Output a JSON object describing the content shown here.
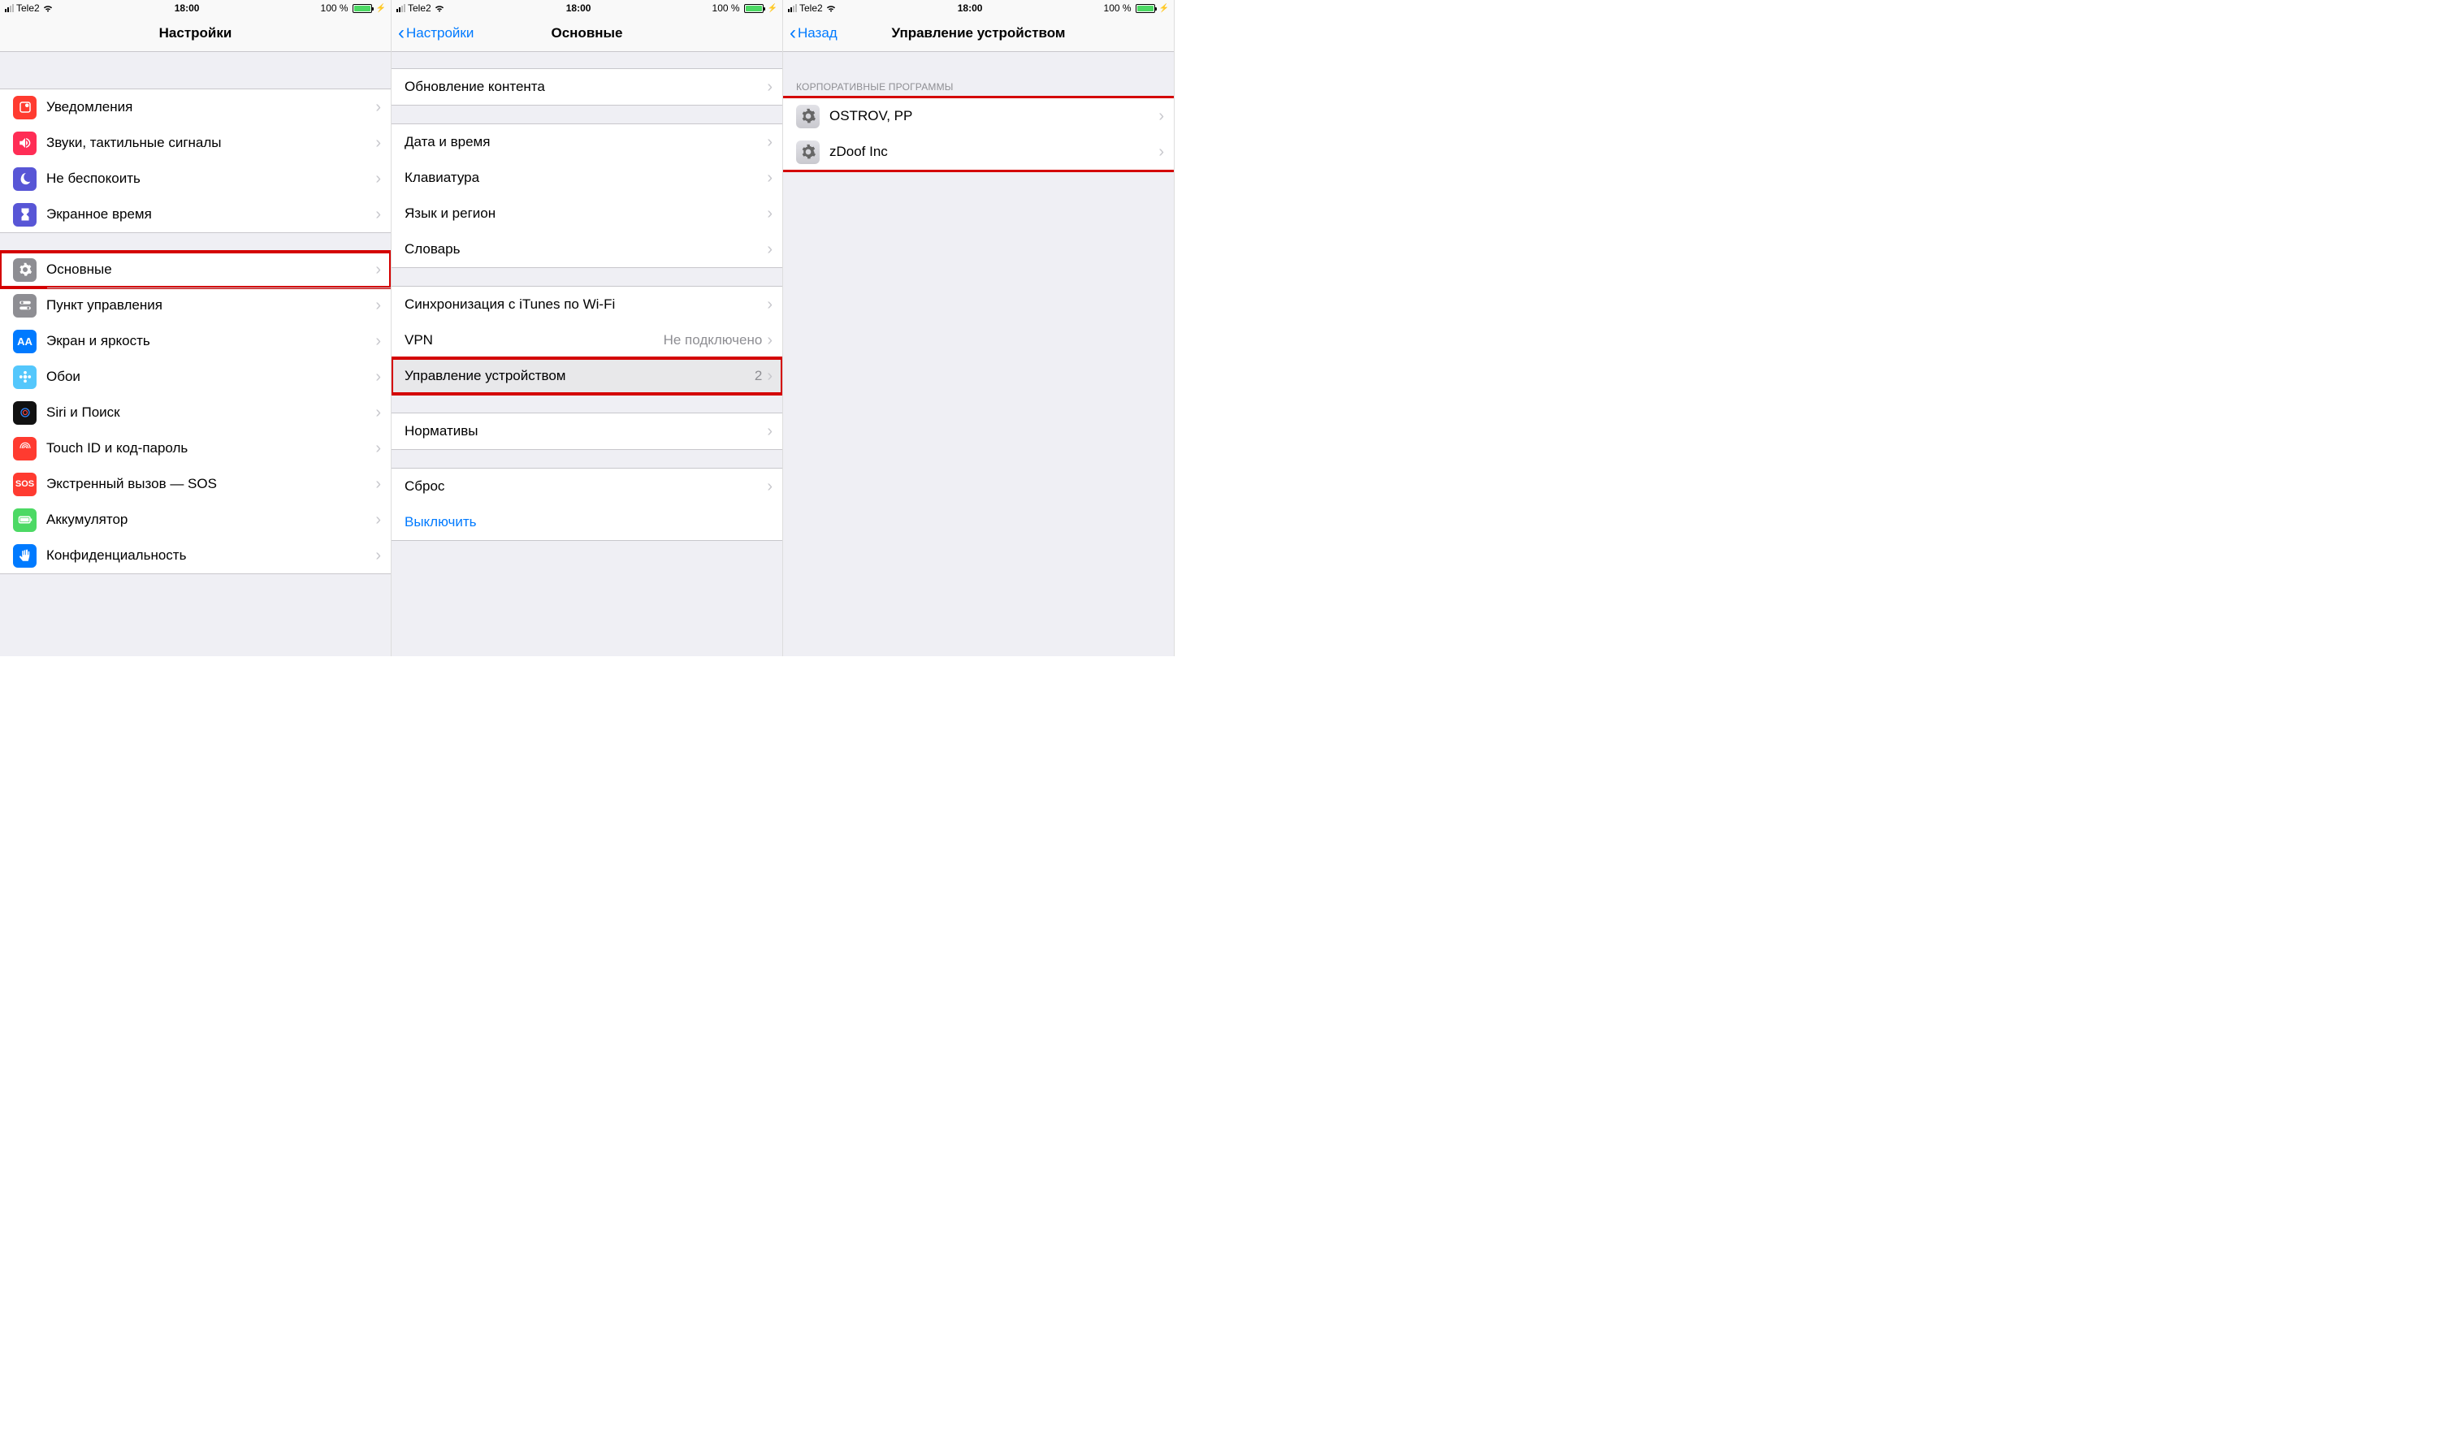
{
  "statusbar": {
    "carrier": "Tele2",
    "time": "18:00",
    "battery": "100 %"
  },
  "screen1": {
    "title": "Настройки",
    "groups": [
      {
        "rows": [
          {
            "id": "notifications",
            "label": "Уведомления",
            "icon": "bell",
            "bg": "#ff3b30"
          },
          {
            "id": "sounds",
            "label": "Звуки, тактильные сигналы",
            "icon": "speaker",
            "bg": "#ff2d55"
          },
          {
            "id": "dnd",
            "label": "Не беспокоить",
            "icon": "moon",
            "bg": "#5856d6"
          },
          {
            "id": "screentime",
            "label": "Экранное время",
            "icon": "hourglass",
            "bg": "#5856d6"
          }
        ]
      },
      {
        "rows": [
          {
            "id": "general",
            "label": "Основные",
            "icon": "gear",
            "bg": "#8e8e93",
            "highlight": true
          },
          {
            "id": "controlcenter",
            "label": "Пункт управления",
            "icon": "toggles",
            "bg": "#8e8e93"
          },
          {
            "id": "display",
            "label": "Экран и яркость",
            "icon": "aa",
            "bg": "#007aff"
          },
          {
            "id": "wallpaper",
            "label": "Обои",
            "icon": "flower",
            "bg": "#54c7fc"
          },
          {
            "id": "siri",
            "label": "Siri и Поиск",
            "icon": "siri",
            "bg": "#111"
          },
          {
            "id": "touchid",
            "label": "Touch ID и код-пароль",
            "icon": "finger",
            "bg": "#ff3b30"
          },
          {
            "id": "sos",
            "label": "Экстренный вызов — SOS",
            "icon": "sos",
            "bg": "#ff3b30"
          },
          {
            "id": "battery",
            "label": "Аккумулятор",
            "icon": "battery",
            "bg": "#4cd964"
          },
          {
            "id": "privacy",
            "label": "Конфиденциальность",
            "icon": "hand",
            "bg": "#007aff"
          }
        ]
      }
    ]
  },
  "screen2": {
    "back": "Настройки",
    "title": "Основные",
    "groups": [
      {
        "rows": [
          {
            "id": "content-update",
            "label": "Обновление контента"
          }
        ]
      },
      {
        "rows": [
          {
            "id": "datetime",
            "label": "Дата и время"
          },
          {
            "id": "keyboard",
            "label": "Клавиатура"
          },
          {
            "id": "language",
            "label": "Язык и регион"
          },
          {
            "id": "dictionary",
            "label": "Словарь"
          }
        ]
      },
      {
        "rows": [
          {
            "id": "itunes-wifi",
            "label": "Синхронизация с iTunes по Wi-Fi"
          },
          {
            "id": "vpn",
            "label": "VPN",
            "detail": "Не подключено"
          },
          {
            "id": "device-mgmt",
            "label": "Управление устройством",
            "detail": "2",
            "highlight": true
          }
        ]
      },
      {
        "rows": [
          {
            "id": "regulatory",
            "label": "Нормативы"
          }
        ]
      },
      {
        "rows": [
          {
            "id": "reset",
            "label": "Сброс"
          },
          {
            "id": "shutdown",
            "label": "Выключить",
            "link": true,
            "nochevron": true
          }
        ]
      }
    ]
  },
  "screen3": {
    "back": "Назад",
    "title": "Управление устройством",
    "header": "КОРПОРАТИВНЫЕ ПРОГРАММЫ",
    "rows": [
      {
        "id": "ostrov",
        "label": "OSTROV, PP"
      },
      {
        "id": "zdoof",
        "label": "zDoof Inc"
      }
    ]
  }
}
